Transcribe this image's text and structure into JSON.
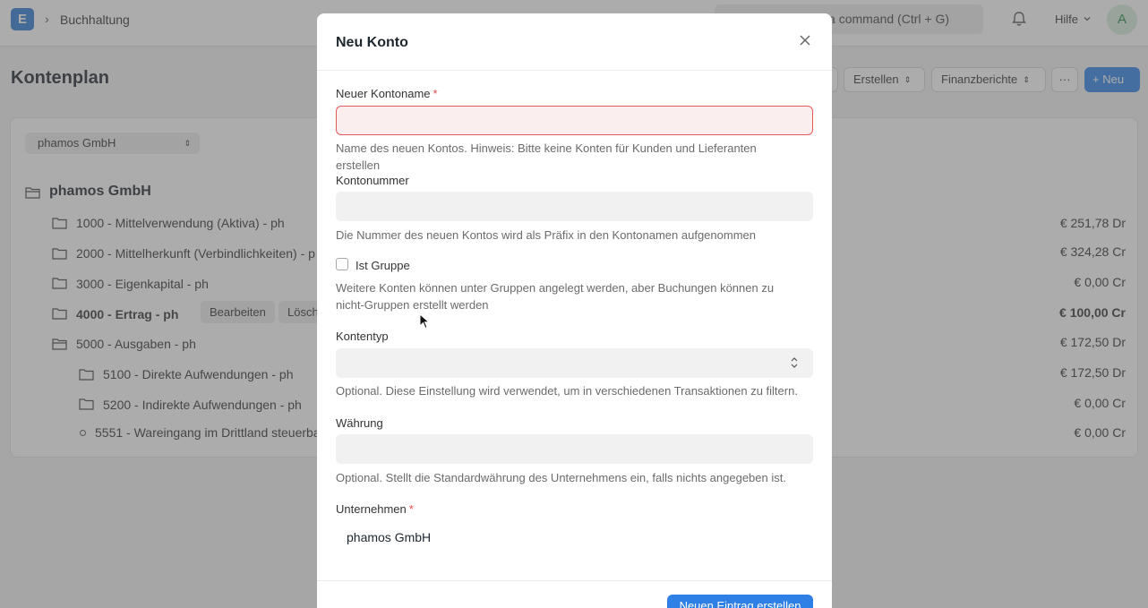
{
  "navbar": {
    "logo_letter": "E",
    "breadcrumb": "Buchhaltung",
    "search_text": "a command (Ctrl + G)",
    "help_label": "Hilfe",
    "avatar_letter": "A"
  },
  "page": {
    "title": "Kontenplan",
    "buttons": {
      "create": "Erstellen",
      "reports": "Finanzberichte",
      "more": "···",
      "new": "+ Neu"
    }
  },
  "tree": {
    "company_filter": "phamos GmbH",
    "root": "phamos GmbH",
    "rows": [
      {
        "label": "1000 - Mittelverwendung (Aktiva) - ph",
        "amount": "€ 251,78 Dr"
      },
      {
        "label": "2000 - Mittelherkunft (Verbindlichkeiten) - p",
        "amount": "€ 324,28 Cr"
      },
      {
        "label": "3000 - Eigenkapital - ph",
        "amount": "€ 0,00 Cr"
      },
      {
        "label": "4000 - Ertrag - ph",
        "amount": "€ 100,00 Cr"
      },
      {
        "label": "5000 - Ausgaben - ph",
        "amount": "€ 172,50 Dr"
      },
      {
        "label": "5100 - Direkte Aufwendungen - ph",
        "amount": "€ 172,50 Dr"
      },
      {
        "label": "5200 - Indirekte Aufwendungen - ph",
        "amount": "€ 0,00 Cr"
      },
      {
        "label": "5551 - Wareingang im Drittland steuerba",
        "amount": "€ 0,00 Cr"
      }
    ],
    "row_actions": {
      "edit": "Bearbeiten",
      "delete": "Lösch"
    }
  },
  "modal": {
    "title": "Neu Konto",
    "fields": {
      "account_name": {
        "label": "Neuer Kontoname",
        "required_mark": "*",
        "value": "",
        "help": "Name des neuen Kontos. Hinweis: Bitte keine Konten für Kunden und Lieferanten erstellen"
      },
      "account_number": {
        "label": "Kontonummer",
        "value": "",
        "help": "Die Nummer des neuen Kontos wird als Präfix in den Kontonamen aufgenommen"
      },
      "is_group": {
        "label": "Ist Gruppe",
        "checked": false,
        "help": "Weitere Konten können unter Gruppen angelegt werden, aber Buchungen können zu nicht-Gruppen erstellt werden"
      },
      "account_type": {
        "label": "Kontentyp",
        "value": "",
        "help": "Optional. Diese Einstellung wird verwendet, um in verschiedenen Transaktionen zu filtern."
      },
      "currency": {
        "label": "Währung",
        "value": "",
        "help": "Optional. Stellt die Standardwährung des Unternehmens ein, falls nichts angegeben ist."
      },
      "company": {
        "label": "Unternehmen",
        "required_mark": "*",
        "value": "phamos GmbH"
      }
    },
    "submit_label": "Neuen Eintrag erstellen"
  },
  "colors": {
    "primary": "#2f80e6",
    "error": "#e35a5a",
    "logo": "#2f7bd6"
  }
}
